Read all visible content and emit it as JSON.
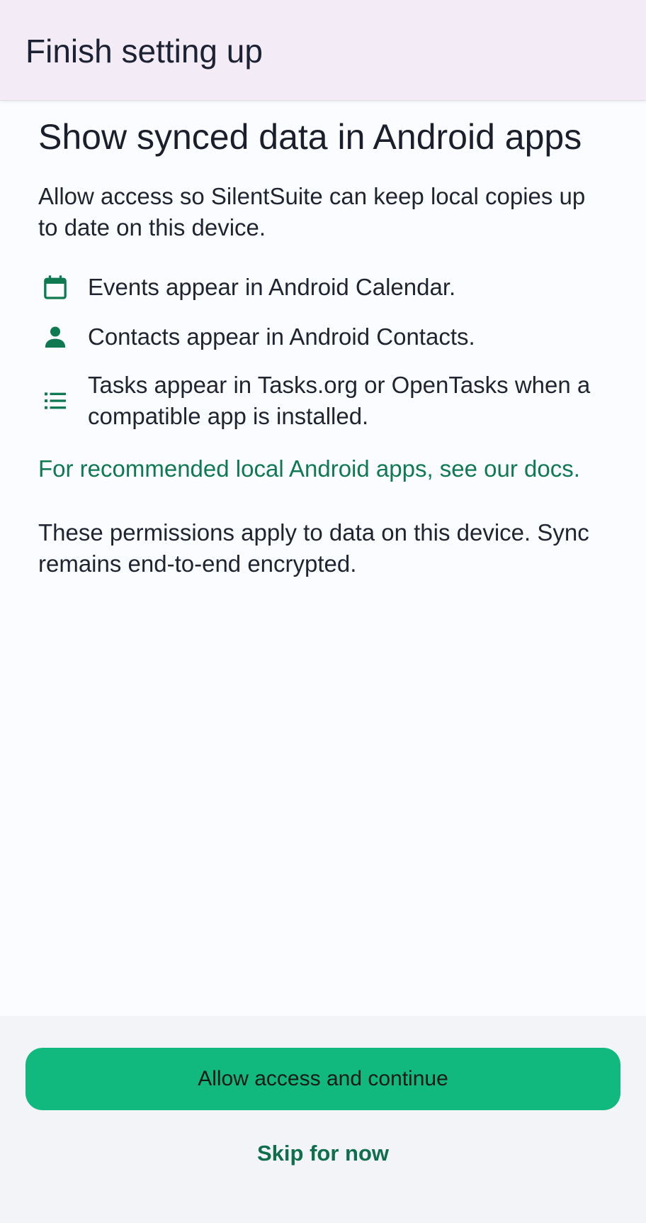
{
  "topbar": {
    "title": "Finish setting up"
  },
  "main": {
    "heading": "Show synced data in Android apps",
    "intro": "Allow access so SilentSuite can keep local copies up to date on this device.",
    "features": [
      {
        "icon": "calendar-icon",
        "text": "Events appear in Android Calendar."
      },
      {
        "icon": "person-icon",
        "text": "Contacts appear in Android Contacts."
      },
      {
        "icon": "list-icon",
        "text": "Tasks appear in Tasks.org or OpenTasks when a compatible app is installed."
      }
    ],
    "docs_link": "For recommended local Android apps, see our docs.",
    "note": "These permissions apply to data on this device. Sync remains end-to-end encrypted."
  },
  "actions": {
    "primary_label": "Allow access and continue",
    "skip_label": "Skip for now"
  },
  "colors": {
    "accent": "#0f7a52",
    "primary_button": "#12b97e",
    "topbar": "#f3ecf6"
  }
}
